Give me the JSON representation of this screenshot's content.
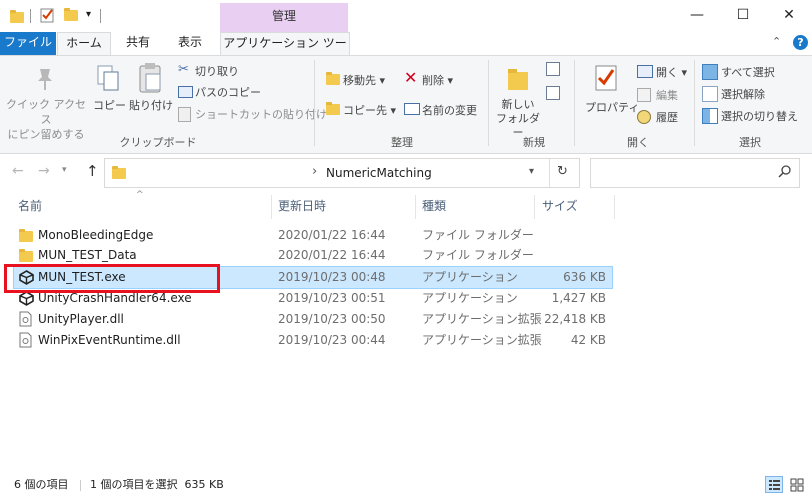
{
  "contextual_tab_group": "管理",
  "window_controls": {
    "minimize": "—",
    "maximize": "☐",
    "close": "✕"
  },
  "tabs": {
    "file": "ファイル",
    "home": "ホーム",
    "share": "共有",
    "view": "表示",
    "app_tools": "アプリケーション ツール"
  },
  "ribbon": {
    "clipboard": {
      "pin": "クイック アクセス\nにピン留めする",
      "copy": "コピー",
      "paste": "貼り付け",
      "cut": "切り取り",
      "copy_path": "パスのコピー",
      "paste_shortcut": "ショートカットの貼り付け",
      "group_label": "クリップボード"
    },
    "organize": {
      "move_to": "移動先",
      "copy_to": "コピー先",
      "delete": "削除",
      "rename": "名前の変更",
      "group_label": "整理"
    },
    "new": {
      "new_folder": "新しい\nフォルダー",
      "group_label": "新規"
    },
    "open": {
      "properties": "プロパティ",
      "open": "開く",
      "edit": "編集",
      "history": "履歴",
      "group_label": "開く"
    },
    "select": {
      "select_all": "すべて選択",
      "select_none": "選択解除",
      "invert": "選択の切り替え",
      "group_label": "選択"
    }
  },
  "address": {
    "path": "NumericMatching",
    "separator": "›"
  },
  "columns": {
    "name": "名前",
    "date": "更新日時",
    "type": "種類",
    "size": "サイズ"
  },
  "files": [
    {
      "name": "MonoBleedingEdge",
      "date": "2020/01/22 16:44",
      "type": "ファイル フォルダー",
      "size": "",
      "icon": "folder-icon"
    },
    {
      "name": "MUN_TEST_Data",
      "date": "2020/01/22 16:44",
      "type": "ファイル フォルダー",
      "size": "",
      "icon": "folder-icon"
    },
    {
      "name": "MUN_TEST.exe",
      "date": "2019/10/23 00:48",
      "type": "アプリケーション",
      "size": "636 KB",
      "icon": "unity-icon"
    },
    {
      "name": "UnityCrashHandler64.exe",
      "date": "2019/10/23 00:51",
      "type": "アプリケーション",
      "size": "1,427 KB",
      "icon": "unity-icon"
    },
    {
      "name": "UnityPlayer.dll",
      "date": "2019/10/23 00:50",
      "type": "アプリケーション拡張",
      "size": "22,418 KB",
      "icon": "dll-icon"
    },
    {
      "name": "WinPixEventRuntime.dll",
      "date": "2019/10/23 00:44",
      "type": "アプリケーション拡張",
      "size": "42 KB",
      "icon": "dll-icon"
    }
  ],
  "status": {
    "count": "6 個の項目",
    "selection": "1 個の項目を選択  635 KB"
  },
  "colors": {
    "accent": "#1979ca",
    "selection": "#cce8ff",
    "highlight_box": "#e8111f",
    "contextual": "#e9cff2"
  }
}
